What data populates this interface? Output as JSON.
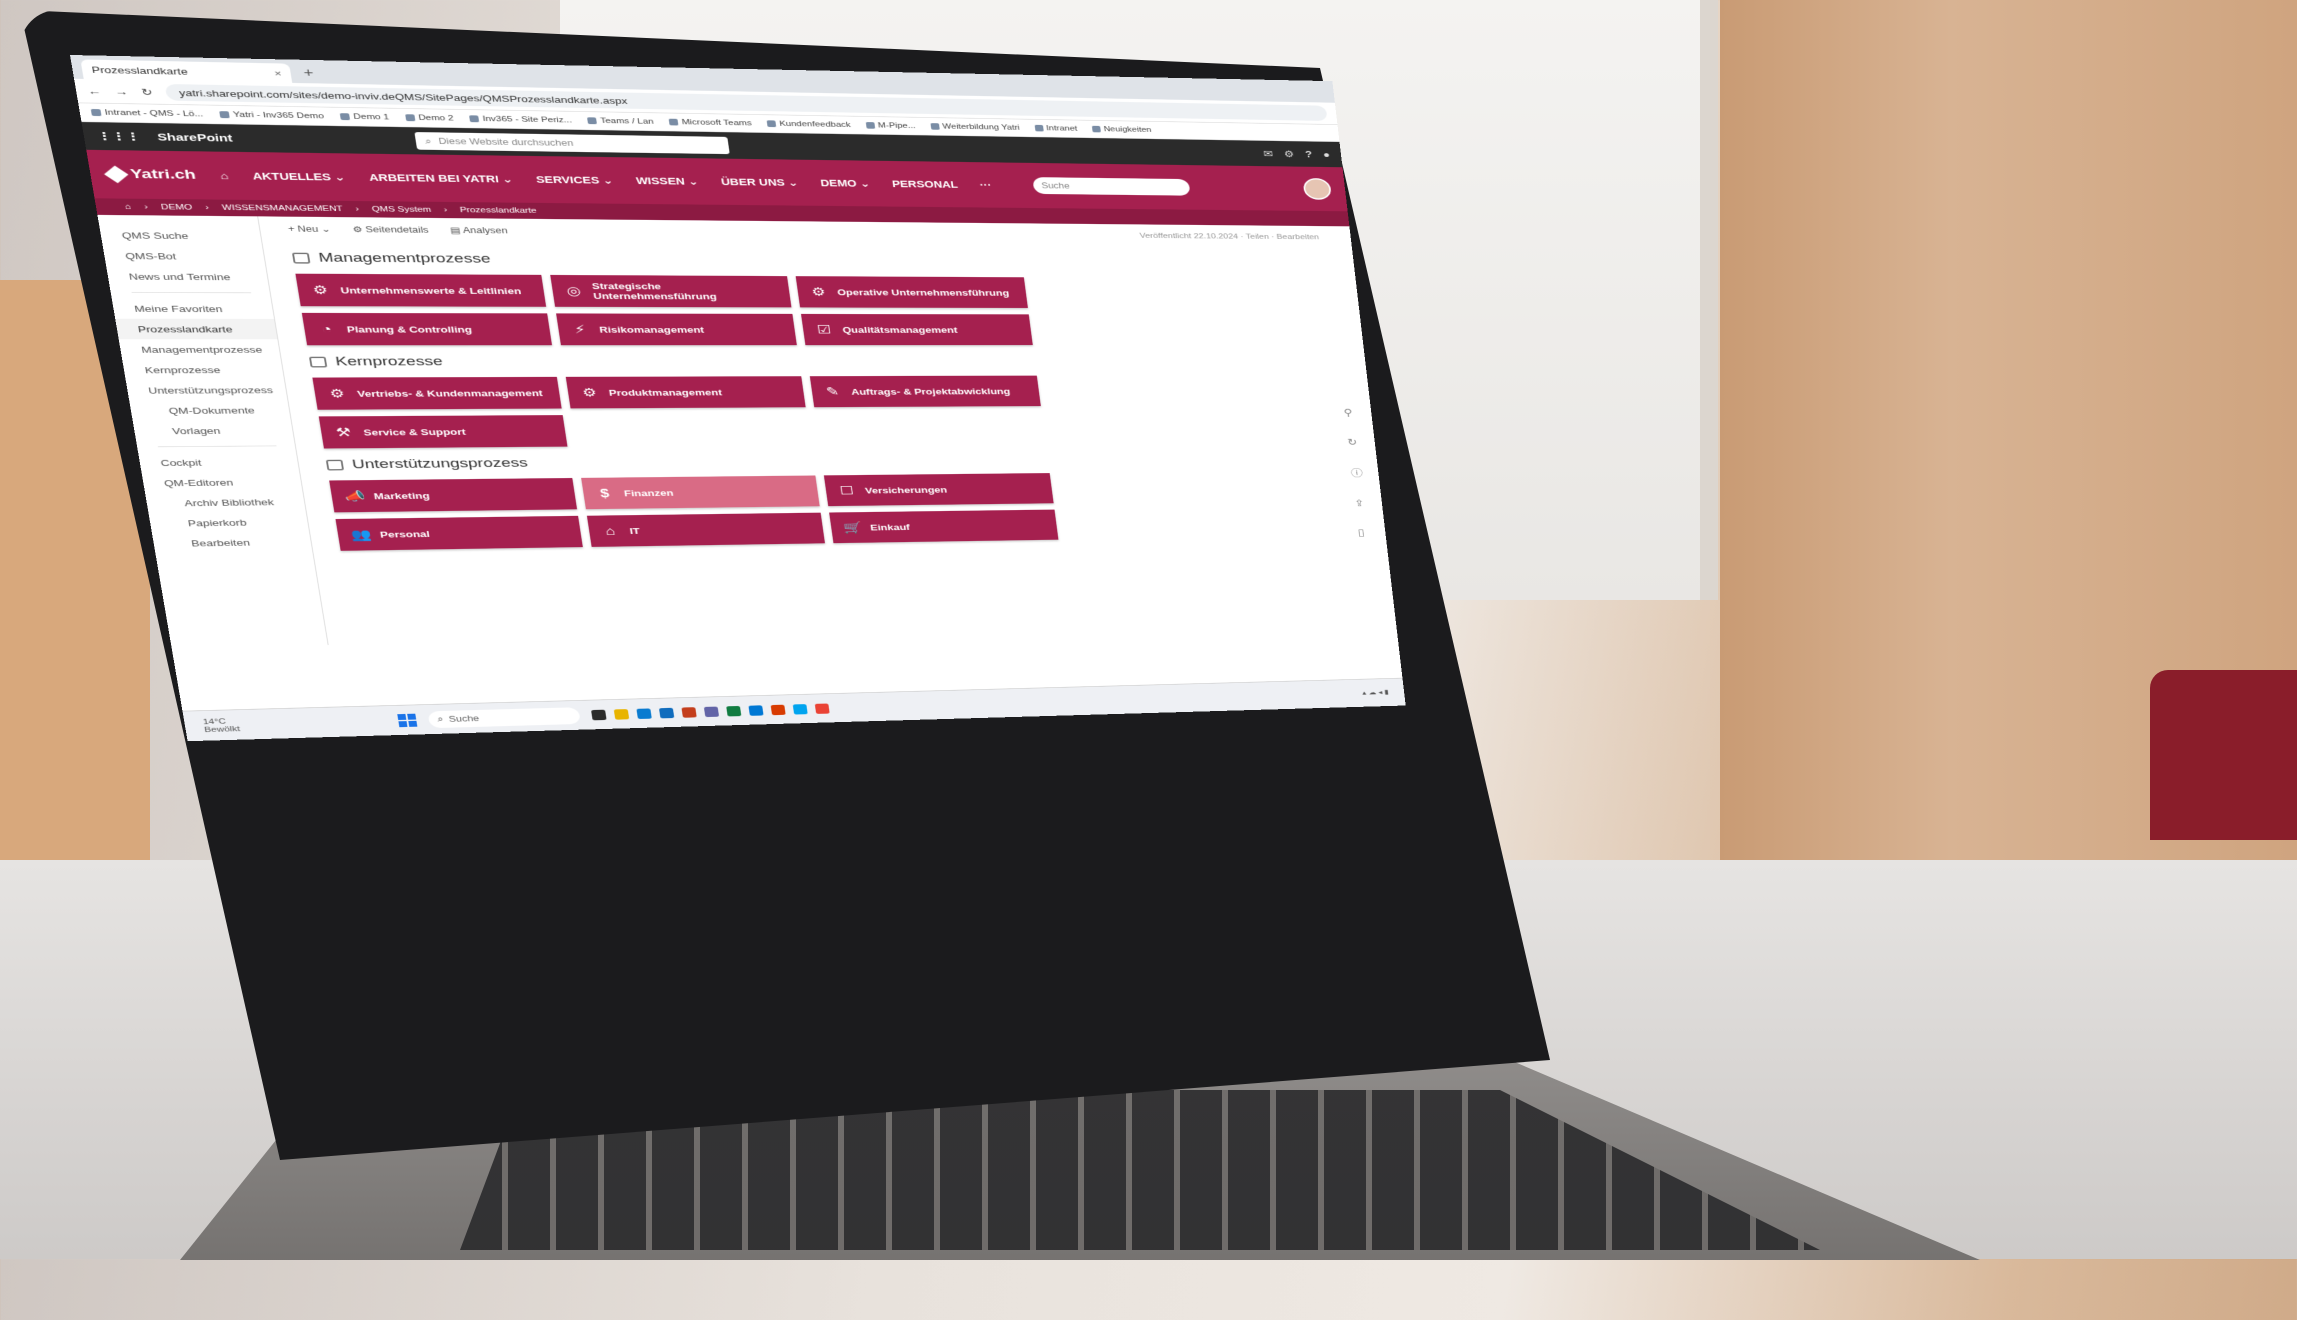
{
  "browser": {
    "tab_title": "Prozesslandkarte",
    "tab_close": "×",
    "new_tab": "+",
    "nav_buttons": [
      "←",
      "→",
      "↻"
    ],
    "url": "yatri.sharepoint.com/sites/demo-inviv.deQMS/SitePages/QMSProzesslandkarte.aspx",
    "bookmarks": [
      "Intranet - QMS - Lö...",
      "Yatri - Inv365 Demo",
      "Demo 1",
      "Demo 2",
      "Inv365 - Site Periz...",
      "Teams / Lan",
      "Microsoft Teams",
      "Kundenfeedback",
      "M-Pipe...",
      "Weiterbildung Yatri",
      "Intranet",
      "Neuigkeiten"
    ]
  },
  "sharepoint": {
    "title": "SharePoint",
    "search_placeholder": "Diese Website durchsuchen",
    "icons": [
      "chat-icon",
      "settings-icon",
      "help-icon",
      "profile-icon"
    ]
  },
  "site_nav": {
    "logo": "Yatri.ch",
    "items": [
      "AKTUELLES ⌄",
      "ARBEITEN BEI YATRI ⌄",
      "SERVICES ⌄",
      "WISSEN ⌄",
      "ÜBER UNS ⌄",
      "DEMO ⌄",
      "PERSONAL",
      "···"
    ],
    "search_placeholder": "Suche"
  },
  "breadcrumb": [
    "DEMO",
    "WISSENSMANAGEMENT",
    "QMS System",
    "Prozesslandkarte"
  ],
  "sidebar": {
    "items": [
      "QMS Suche",
      "QMS-Bot",
      "News und Termine",
      "Meine Favoriten",
      "Prozesslandkarte",
      "Managementprozesse",
      "Kernprozesse",
      "Unterstützungsprozess",
      "QM-Dokumente",
      "Vorlagen",
      "Cockpit",
      "QM-Editoren",
      "Archiv Bibliothek",
      "Papierkorb",
      "Bearbeiten"
    ]
  },
  "commandbar": {
    "new": "+ Neu ⌄",
    "page_details": "Seitendetails",
    "analytics": "Analysen",
    "right": "Veröffentlicht 22.10.2024 · Teilen · Bearbeiten"
  },
  "sections": [
    {
      "title": "Managementprozesse",
      "tiles": [
        {
          "label": "Unternehmenswerte & Leitlinien",
          "icon": "⚙"
        },
        {
          "label": "Strategische Unternehmensführung",
          "icon": "◎"
        },
        {
          "label": "Operative Unternehmensführung",
          "icon": "⚙"
        },
        {
          "label": "Planung & Controlling",
          "icon": "◔"
        },
        {
          "label": "Risikomanagement",
          "icon": "⚡"
        },
        {
          "label": "Qualitätsmanagement",
          "icon": "☑"
        }
      ]
    },
    {
      "title": "Kernprozesse",
      "tiles": [
        {
          "label": "Vertriebs- & Kundenmanagement",
          "icon": "⚙"
        },
        {
          "label": "Produktmanagement",
          "icon": "⚙"
        },
        {
          "label": "Auftrags- & Projektabwicklung",
          "icon": "✎"
        },
        {
          "label": "Service & Support",
          "icon": "⚒"
        }
      ]
    },
    {
      "title": "Unterstützungsprozess",
      "tiles": [
        {
          "label": "Marketing",
          "icon": "📣"
        },
        {
          "label": "Finanzen",
          "icon": "$",
          "highlight": true
        },
        {
          "label": "Versicherungen",
          "icon": "☐"
        },
        {
          "label": "Personal",
          "icon": "👥"
        },
        {
          "label": "IT",
          "icon": "⌂"
        },
        {
          "label": "Einkauf",
          "icon": "🛒"
        }
      ]
    }
  ],
  "taskbar": {
    "temperature": "14°C",
    "weather": "Bewölkt",
    "search": "Suche",
    "app_colors": [
      "#2b2b2b",
      "#e8b400",
      "#0a7bd0",
      "#0f6cbd",
      "#c43e1c",
      "#6264a7",
      "#107c41",
      "#0078d4",
      "#d83b01",
      "#00a4ef",
      "#ea4335"
    ]
  },
  "colors": {
    "brand": "#a5204f",
    "brand_dark": "#8c1a42",
    "tile_highlight": "#d96b85",
    "sharepoint_bar": "#2b2b2b"
  }
}
